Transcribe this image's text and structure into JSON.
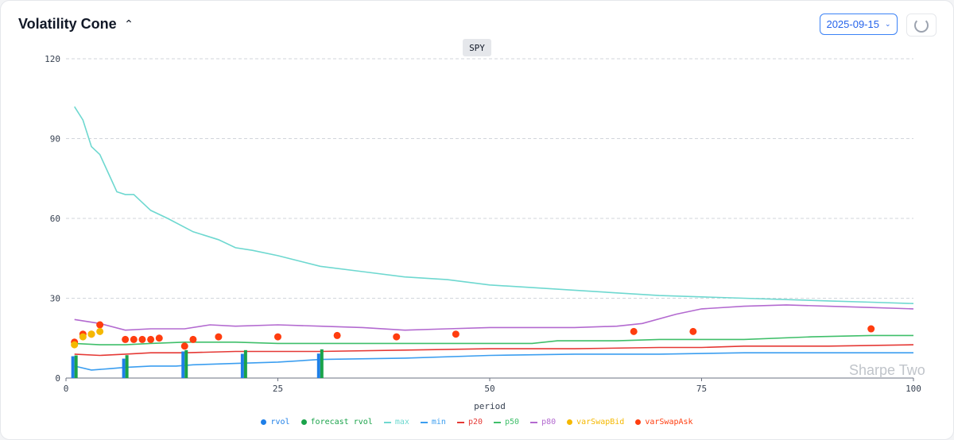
{
  "header": {
    "title": "Volatility Cone",
    "date": "2025-09-15"
  },
  "symbol": "SPY",
  "watermark": "Sharpe Two",
  "colors": {
    "rvol": "#1e7fe8",
    "forecast_rvol": "#1aa34a",
    "max": "#6ed8d0",
    "min": "#3b9ef0",
    "p20": "#e53935",
    "p50": "#3fbf6a",
    "p80": "#b36ad0",
    "varSwapBid": "#f5b800",
    "varSwapAsk": "#ff3d0f"
  },
  "chart_data": {
    "type": "line",
    "title": "",
    "xlabel": "period",
    "ylabel": "",
    "xlim": [
      0,
      100
    ],
    "ylim": [
      0,
      120
    ],
    "x_ticks": [
      "0",
      "25",
      "50",
      "75",
      "100"
    ],
    "y_ticks": [
      "0",
      "30",
      "60",
      "90",
      "120"
    ],
    "grid": true,
    "legend_position": "bottom",
    "legend": [
      "rvol",
      "forecast rvol",
      "max",
      "min",
      "p20",
      "p50",
      "p80",
      "varSwapBid",
      "varSwapAsk"
    ],
    "bars": {
      "x": [
        1,
        7,
        14,
        21,
        30
      ],
      "rvol": [
        8.2,
        7.3,
        10.0,
        9.1,
        9.2
      ],
      "forecast_rvol": [
        8.5,
        8.6,
        10.5,
        10.5,
        10.8
      ]
    },
    "series": [
      {
        "name": "max",
        "x": [
          1,
          2,
          3,
          4,
          5,
          6,
          7,
          8,
          9,
          10,
          12,
          15,
          18,
          20,
          22,
          25,
          30,
          35,
          40,
          45,
          50,
          55,
          60,
          65,
          70,
          75,
          80,
          85,
          90,
          95,
          100
        ],
        "y": [
          102,
          97,
          87,
          84,
          77,
          70,
          69,
          69,
          66,
          63,
          60,
          55,
          52,
          49,
          48,
          46,
          42,
          40,
          38,
          37,
          35,
          34,
          33,
          32,
          31,
          30.5,
          30,
          29.5,
          29,
          28.5,
          28
        ]
      },
      {
        "name": "p80",
        "x": [
          1,
          4,
          7,
          10,
          14,
          17,
          20,
          25,
          30,
          35,
          40,
          45,
          50,
          55,
          60,
          65,
          68,
          72,
          75,
          80,
          85,
          90,
          95,
          100
        ],
        "y": [
          22,
          20.5,
          18,
          18.5,
          18.5,
          20,
          19.5,
          20,
          19.5,
          19,
          18,
          18.5,
          19,
          19,
          19,
          19.5,
          20.5,
          24,
          26,
          27,
          27.5,
          27,
          26.5,
          26
        ]
      },
      {
        "name": "p50",
        "x": [
          1,
          4,
          7,
          10,
          14,
          20,
          25,
          30,
          40,
          50,
          55,
          58,
          65,
          70,
          80,
          88,
          95,
          100
        ],
        "y": [
          13,
          12.5,
          12.5,
          13,
          13.5,
          13.5,
          13,
          13,
          13,
          13,
          13,
          14,
          14,
          14.5,
          14.5,
          15.5,
          16,
          16
        ]
      },
      {
        "name": "p20",
        "x": [
          1,
          4,
          7,
          10,
          14,
          20,
          25,
          30,
          40,
          50,
          60,
          70,
          75,
          80,
          90,
          100
        ],
        "y": [
          9,
          8.5,
          9,
          9.5,
          9.5,
          10,
          10,
          10,
          10.5,
          11,
          11,
          11.5,
          11.5,
          12,
          12,
          12.5
        ]
      },
      {
        "name": "min",
        "x": [
          1,
          3,
          5,
          7,
          10,
          13,
          15,
          20,
          25,
          30,
          40,
          50,
          60,
          70,
          80,
          90,
          100
        ],
        "y": [
          4.5,
          3,
          3.5,
          4,
          4.5,
          4.5,
          5,
          5.5,
          6,
          7,
          7.5,
          8.5,
          9,
          9,
          9.5,
          9.5,
          9.5
        ]
      }
    ],
    "varSwapBid": {
      "x": [
        1,
        2,
        3,
        4
      ],
      "y": [
        12.5,
        15.5,
        16.5,
        17.5
      ]
    },
    "varSwapAsk": {
      "x": [
        1,
        2,
        3,
        4,
        7,
        8,
        9,
        10,
        11,
        14,
        15,
        18,
        25,
        32,
        39,
        46,
        67,
        74,
        95
      ],
      "y": [
        13.5,
        16.5,
        16.5,
        20,
        14.5,
        14.5,
        14.5,
        14.5,
        15,
        12,
        14.5,
        15.5,
        15.5,
        16,
        15.5,
        16.5,
        17.5,
        17.5,
        18.5
      ]
    }
  }
}
